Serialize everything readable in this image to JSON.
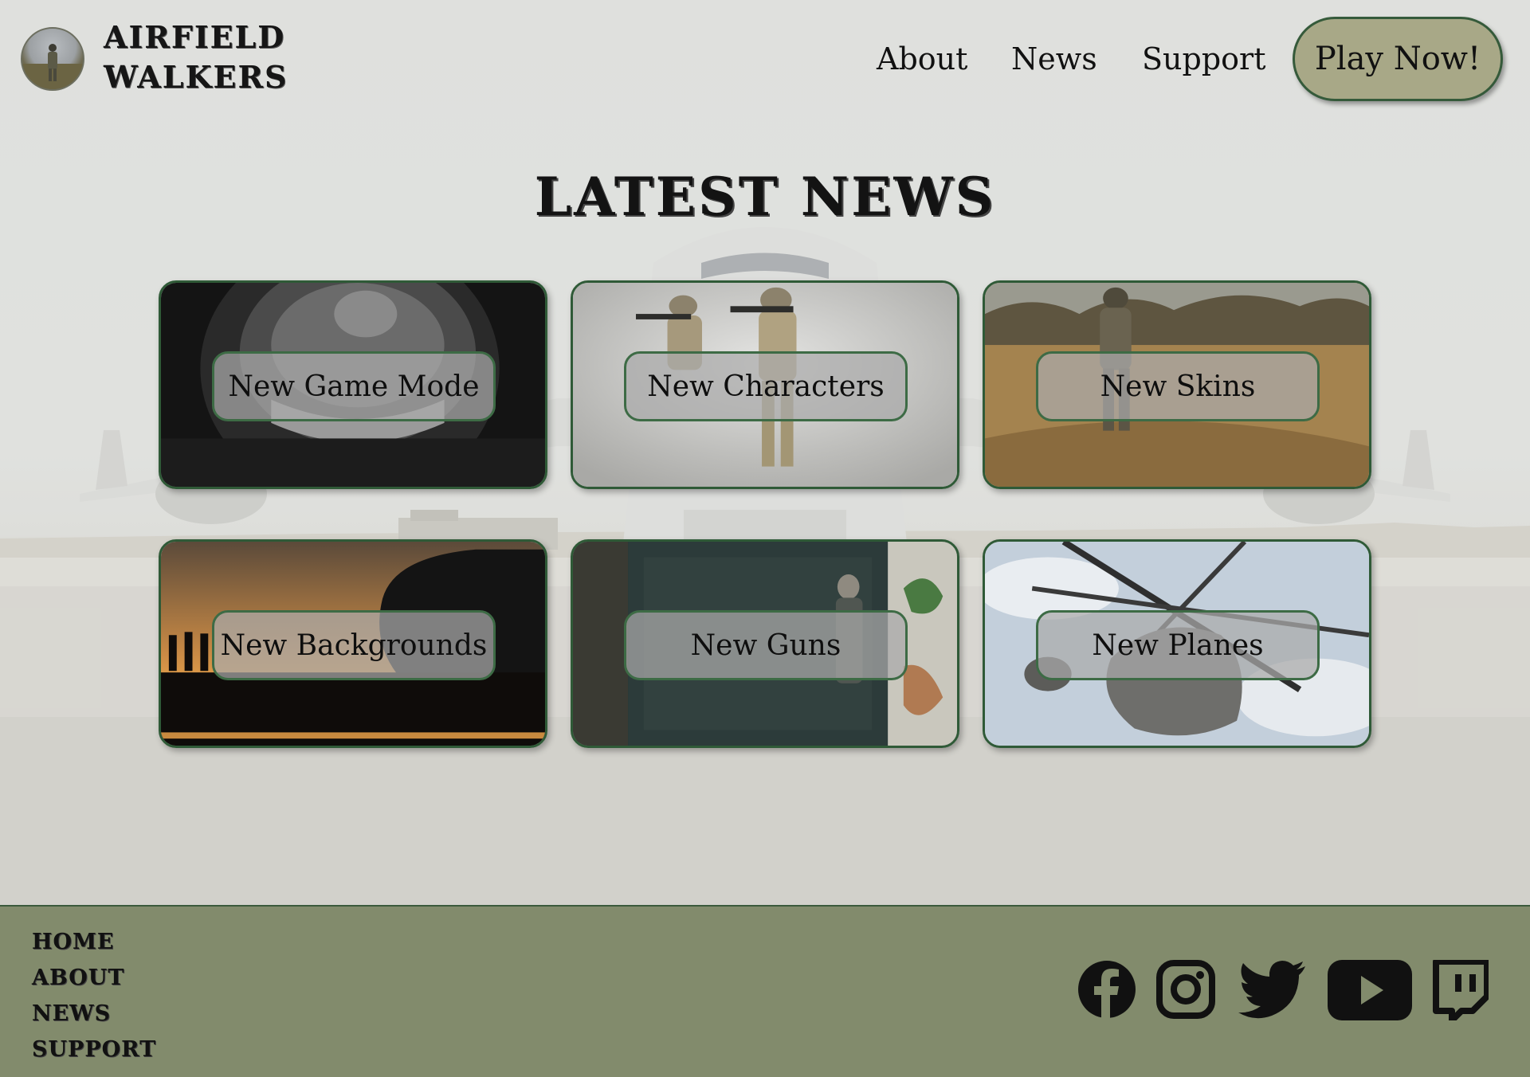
{
  "brand": {
    "line1": "AIRFIELD",
    "line2": "WALKERS"
  },
  "nav": {
    "about": "About",
    "news": "News",
    "support": "Support",
    "play": "Play Now!"
  },
  "main": {
    "title": "LATEST NEWS",
    "cards": [
      {
        "label": "New Game Mode",
        "image": "zombie-face"
      },
      {
        "label": "New Characters",
        "image": "soldiers-aiming"
      },
      {
        "label": "New Skins",
        "image": "soldier-field"
      },
      {
        "label": "New Backgrounds",
        "image": "plane-sunset"
      },
      {
        "label": "New Guns",
        "image": "zombie-door"
      },
      {
        "label": "New Planes",
        "image": "helicopter"
      }
    ]
  },
  "footer": {
    "links": [
      "HOME",
      "ABOUT",
      "NEWS",
      "SUPPORT"
    ],
    "social_icons": [
      "facebook-icon",
      "instagram-icon",
      "twitter-icon",
      "youtube-icon",
      "twitch-icon"
    ]
  },
  "colors": {
    "accent_green": "#2f5a37",
    "play_button": "#a8a887",
    "footer": "#828b6c"
  }
}
